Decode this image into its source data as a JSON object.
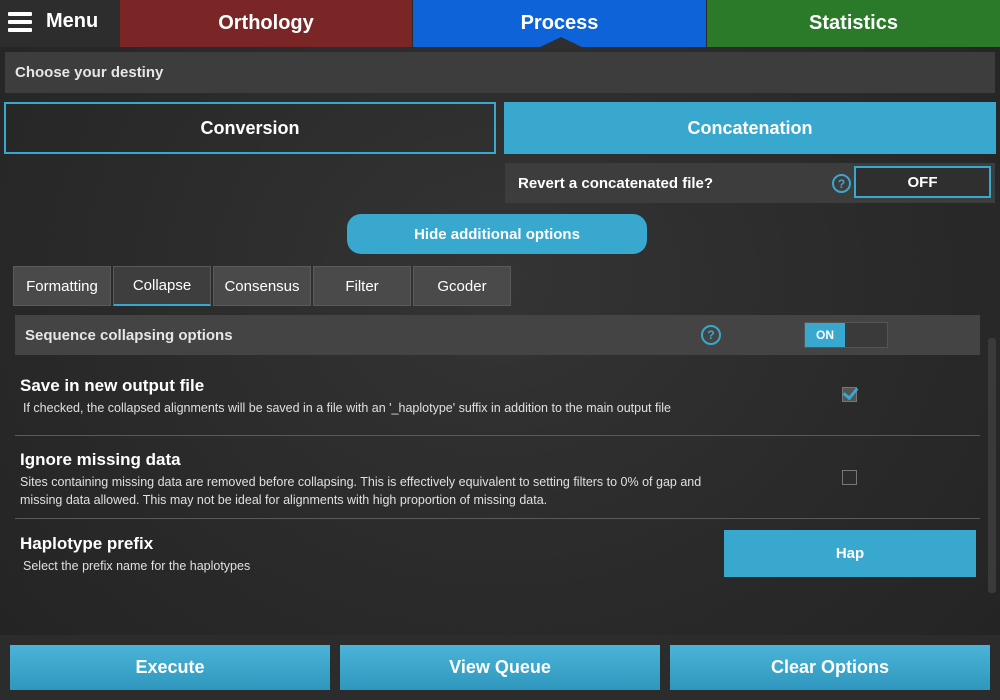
{
  "topbar": {
    "menu_label": "Menu",
    "tabs": [
      {
        "label": "Orthology",
        "color": "#7a2626"
      },
      {
        "label": "Process",
        "color": "#0f63d8",
        "active": true
      },
      {
        "label": "Statistics",
        "color": "#2a7a2a"
      }
    ]
  },
  "subtitle": "Choose your destiny",
  "modes": {
    "conversion": "Conversion",
    "concatenation": "Concatenation",
    "selected": "Concatenation"
  },
  "revert": {
    "label": "Revert a concatenated file?",
    "toggle_value": "OFF"
  },
  "hide_options_label": "Hide additional options",
  "sub_tabs": [
    {
      "label": "Formatting"
    },
    {
      "label": "Collapse",
      "active": true
    },
    {
      "label": "Consensus"
    },
    {
      "label": "Filter"
    },
    {
      "label": "Gcoder"
    }
  ],
  "panel": {
    "title": "Sequence collapsing options",
    "toggle_value": "ON",
    "options": {
      "save": {
        "title": "Save in new output file",
        "description": "If checked, the collapsed alignments will be saved in a file with an '_haplotype' suffix in addition to the main output file",
        "checked": true
      },
      "ignore": {
        "title": "Ignore missing data",
        "description": "Sites containing missing data are removed before collapsing. This is effectively equivalent to setting filters to 0% of gap and missing data allowed. This may not be ideal for alignments with high proportion of missing data.",
        "checked": false
      },
      "prefix": {
        "title": "Haplotype prefix",
        "description": "Select the prefix name for the haplotypes",
        "value": "Hap"
      }
    }
  },
  "footer": {
    "execute": "Execute",
    "view_queue": "View Queue",
    "clear_options": "Clear Options"
  },
  "colors": {
    "accent": "#38a8cf"
  },
  "icons": {
    "menu": "hamburger-icon",
    "help": "question-circle-icon",
    "check": "checkmark-icon"
  }
}
